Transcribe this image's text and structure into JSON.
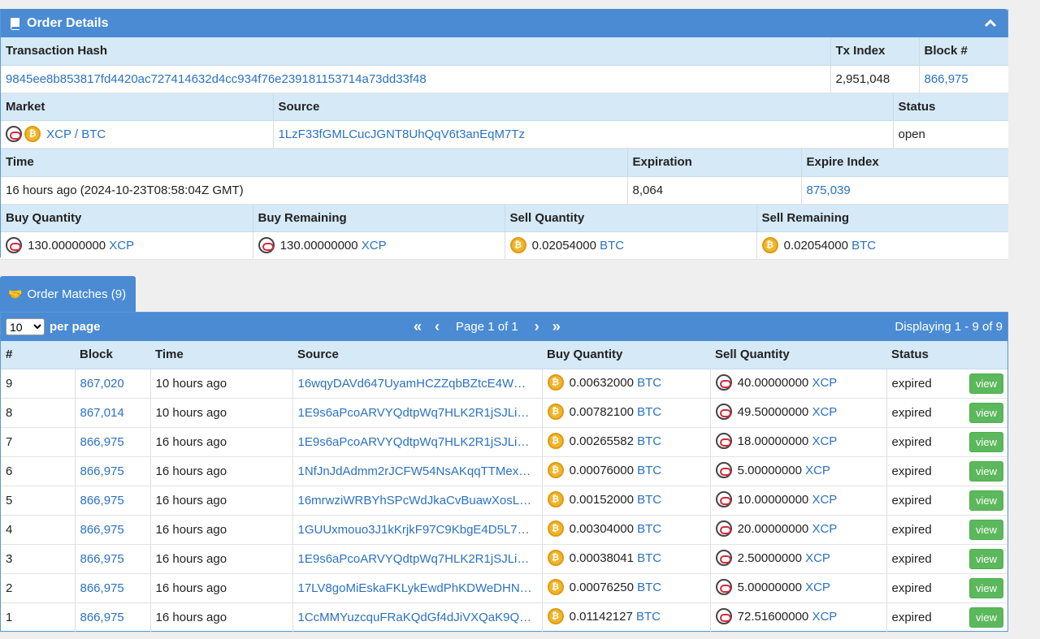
{
  "order_details": {
    "title": "Order Details",
    "headers": {
      "tx_hash": "Transaction Hash",
      "tx_index": "Tx Index",
      "block": "Block #"
    },
    "tx_hash": "9845ee8b853817fd4420ac727414632d4cc934f76e239181153714a73dd33f48",
    "tx_index": "2,951,048",
    "block": "866,975",
    "market_label": "Market",
    "source_label": "Source",
    "status_label": "Status",
    "market": "XCP / BTC",
    "source": "1LzF33fGMLCucJGNT8UhQqV6t3anEqM7Tz",
    "status": "open",
    "time_label": "Time",
    "expiration_label": "Expiration",
    "expire_index_label": "Expire Index",
    "time": "16 hours ago (2024-10-23T08:58:04Z GMT)",
    "expiration": "8,064",
    "expire_index": "875,039",
    "buy_quantity_label": "Buy Quantity",
    "buy_remaining_label": "Buy Remaining",
    "sell_quantity_label": "Sell Quantity",
    "sell_remaining_label": "Sell Remaining",
    "buy_quantity": {
      "amount": "130.00000000",
      "asset": "XCP"
    },
    "buy_remaining": {
      "amount": "130.00000000",
      "asset": "XCP"
    },
    "sell_quantity": {
      "amount": "0.02054000",
      "asset": "BTC"
    },
    "sell_remaining": {
      "amount": "0.02054000",
      "asset": "BTC"
    }
  },
  "matches_tab": {
    "label": "Order Matches (9)"
  },
  "toolbar": {
    "per_page_value": "10",
    "per_page_label": "per page",
    "first": "«",
    "prev": "‹",
    "page_text": "Page 1 of 1",
    "next": "›",
    "last": "»",
    "displaying": "Displaying 1 - 9 of 9"
  },
  "matches": {
    "columns": [
      "#",
      "Block",
      "Time",
      "Source",
      "Buy Quantity",
      "Sell Quantity",
      "Status"
    ],
    "view_label": "view",
    "rows": [
      {
        "num": "9",
        "block": "867,020",
        "time": "10 hours ago",
        "source": "16wqyDAVd647UyamHCZZqbBZtcE4W…",
        "buy_amount": "0.00632000",
        "buy_asset": "BTC",
        "sell_amount": "40.00000000",
        "sell_asset": "XCP",
        "status": "expired"
      },
      {
        "num": "8",
        "block": "867,014",
        "time": "10 hours ago",
        "source": "1E9s6aPcoARVYQdtpWq7HLK2R1jSJLi…",
        "buy_amount": "0.00782100",
        "buy_asset": "BTC",
        "sell_amount": "49.50000000",
        "sell_asset": "XCP",
        "status": "expired"
      },
      {
        "num": "7",
        "block": "866,975",
        "time": "16 hours ago",
        "source": "1E9s6aPcoARVYQdtpWq7HLK2R1jSJLi…",
        "buy_amount": "0.00265582",
        "buy_asset": "BTC",
        "sell_amount": "18.00000000",
        "sell_asset": "XCP",
        "status": "expired"
      },
      {
        "num": "6",
        "block": "866,975",
        "time": "16 hours ago",
        "source": "1NfJnJdAdmm2rJCFW54NsAKqqTTMex…",
        "buy_amount": "0.00076000",
        "buy_asset": "BTC",
        "sell_amount": "5.00000000",
        "sell_asset": "XCP",
        "status": "expired"
      },
      {
        "num": "5",
        "block": "866,975",
        "time": "16 hours ago",
        "source": "16mrwziWRBYhSPcWdJkaCvBuawXosL…",
        "buy_amount": "0.00152000",
        "buy_asset": "BTC",
        "sell_amount": "10.00000000",
        "sell_asset": "XCP",
        "status": "expired"
      },
      {
        "num": "4",
        "block": "866,975",
        "time": "16 hours ago",
        "source": "1GUUxmouo3J1kKrjkF97C9KbgE4D5L7…",
        "buy_amount": "0.00304000",
        "buy_asset": "BTC",
        "sell_amount": "20.00000000",
        "sell_asset": "XCP",
        "status": "expired"
      },
      {
        "num": "3",
        "block": "866,975",
        "time": "16 hours ago",
        "source": "1E9s6aPcoARVYQdtpWq7HLK2R1jSJLi…",
        "buy_amount": "0.00038041",
        "buy_asset": "BTC",
        "sell_amount": "2.50000000",
        "sell_asset": "XCP",
        "status": "expired"
      },
      {
        "num": "2",
        "block": "866,975",
        "time": "16 hours ago",
        "source": "17LV8goMiEskaFKLykEwdPhKDWeDHN…",
        "buy_amount": "0.00076250",
        "buy_asset": "BTC",
        "sell_amount": "5.00000000",
        "sell_asset": "XCP",
        "status": "expired"
      },
      {
        "num": "1",
        "block": "866,975",
        "time": "16 hours ago",
        "source": "1CcMMYuzcquFRaKQdGf4dJiVXQaK9Q…",
        "buy_amount": "0.01142127",
        "buy_asset": "BTC",
        "sell_amount": "72.51600000",
        "sell_asset": "XCP",
        "status": "expired"
      }
    ]
  },
  "colors": {
    "header_blue": "#4a8bd3",
    "subheader_blue": "#d5e9f6",
    "link": "#2a72c2",
    "view_green": "#5cb85c"
  }
}
